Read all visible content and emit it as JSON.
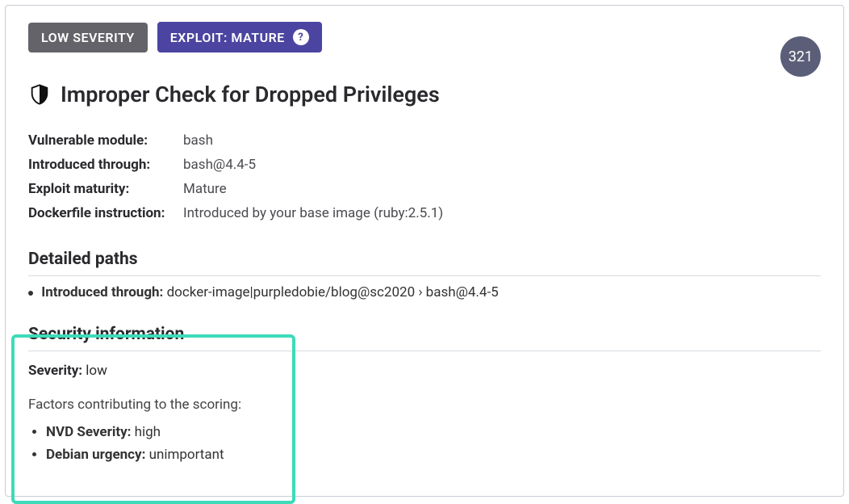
{
  "badges": {
    "severity": "LOW SEVERITY",
    "exploit": "EXPLOIT: MATURE"
  },
  "count": "321",
  "title": "Improper Check for Dropped Privileges",
  "meta": {
    "vulnerable_module_label": "Vulnerable module:",
    "vulnerable_module_value": "bash",
    "introduced_through_label": "Introduced through:",
    "introduced_through_value": "bash@4.4-5",
    "exploit_maturity_label": "Exploit maturity:",
    "exploit_maturity_value": "Mature",
    "dockerfile_label": "Dockerfile instruction:",
    "dockerfile_value": "Introduced by your base image (ruby:2.5.1)"
  },
  "detailed_paths": {
    "title": "Detailed paths",
    "row_label": "Introduced through:",
    "row_value": "docker-image|purpledobie/blog@sc2020 › bash@4.4-5"
  },
  "security_info": {
    "title": "Security information",
    "severity_label": "Severity:",
    "severity_value": "low",
    "factors_intro": "Factors contributing to the scoring:",
    "factor1_label": "NVD Severity:",
    "factor1_value": "high",
    "factor2_label": "Debian urgency:",
    "factor2_value": "unimportant"
  }
}
